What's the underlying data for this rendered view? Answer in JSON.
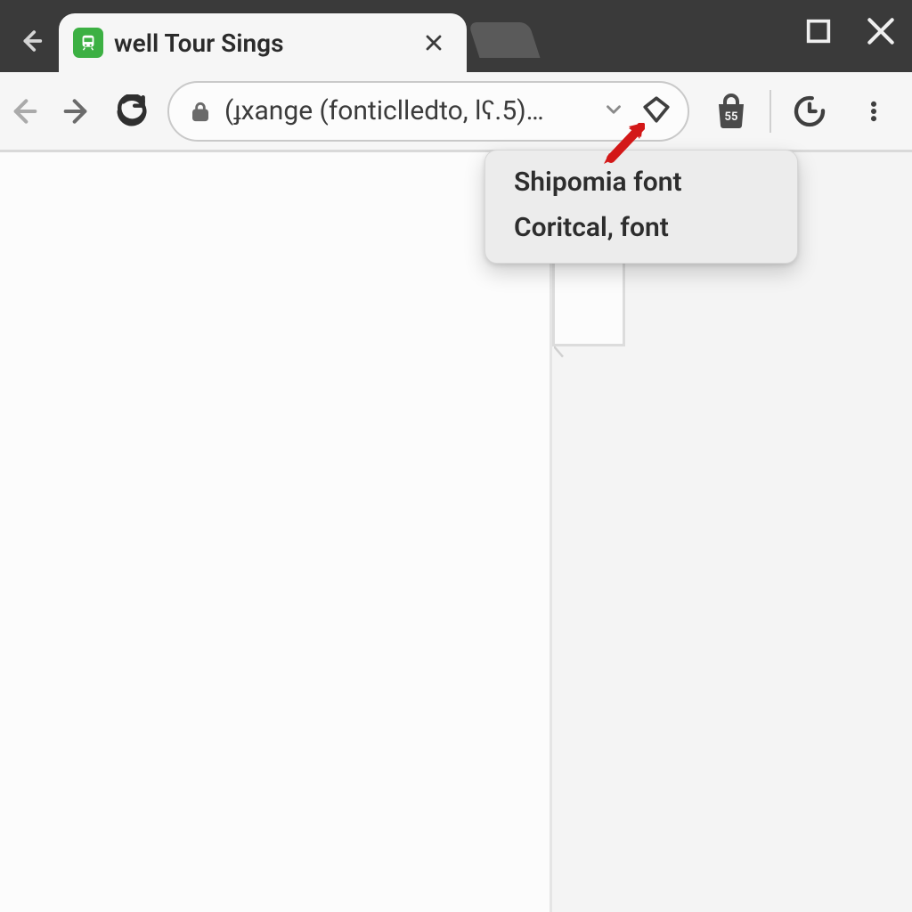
{
  "tab": {
    "title": "well Tour Sings"
  },
  "omnibox": {
    "url_display": "(ɟxange (fonticlledto, lʕ.5)…"
  },
  "extension_badge": "55",
  "dropdown": {
    "items": [
      "Shipomia font",
      "Coritcal, font"
    ]
  }
}
